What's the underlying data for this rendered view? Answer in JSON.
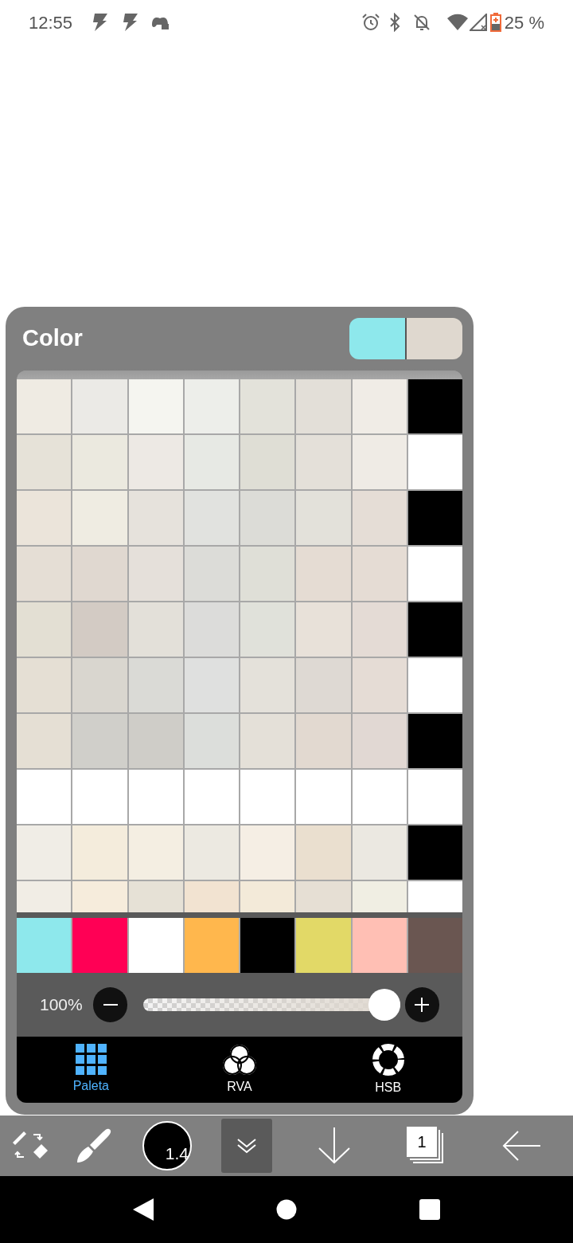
{
  "status_bar": {
    "time": "12:55",
    "battery": "25 %"
  },
  "color_panel": {
    "title": "Color",
    "current_colors": [
      {
        "color": "#8ee8ec"
      },
      {
        "color": "#dfd8cf"
      }
    ],
    "palette": {
      "rows": [
        {
          "swatches": [
            {
              "color": "#efebe3"
            },
            {
              "color": "#ebeae6"
            },
            {
              "color": "#f5f5f0"
            },
            {
              "color": "#edeeea"
            },
            {
              "color": "#e3e2da"
            },
            {
              "color": "#e3dfd8"
            },
            {
              "color": "#f0ece6"
            },
            {
              "color": "#000000"
            }
          ]
        },
        {
          "swatches": [
            {
              "color": "#e6e2d8"
            },
            {
              "color": "#ebe9df"
            },
            {
              "color": "#ede9e4"
            },
            {
              "color": "#e7e9e4"
            },
            {
              "color": "#dfded5"
            },
            {
              "color": "#e4e0d9"
            },
            {
              "color": "#efebe5"
            },
            {
              "color": "#ffffff"
            }
          ]
        },
        {
          "swatches": [
            {
              "color": "#ebe4da"
            },
            {
              "color": "#efece2"
            },
            {
              "color": "#e6e2dc"
            },
            {
              "color": "#e1e2df"
            },
            {
              "color": "#dcdcd7"
            },
            {
              "color": "#e3e1da"
            },
            {
              "color": "#e5ddd6"
            },
            {
              "color": "#000000"
            }
          ]
        },
        {
          "swatches": [
            {
              "color": "#e5ded5"
            },
            {
              "color": "#e0d8d0"
            },
            {
              "color": "#e5e0da"
            },
            {
              "color": "#dcdcd8"
            },
            {
              "color": "#dfdfd7"
            },
            {
              "color": "#e5dcd3"
            },
            {
              "color": "#e5dcd4"
            },
            {
              "color": "#ffffff"
            }
          ]
        },
        {
          "swatches": [
            {
              "color": "#e3dfd3"
            },
            {
              "color": "#d3cbc4"
            },
            {
              "color": "#e3e0d9"
            },
            {
              "color": "#dcdcda"
            },
            {
              "color": "#e0e1da"
            },
            {
              "color": "#e8e1d9"
            },
            {
              "color": "#e4dbd5"
            },
            {
              "color": "#000000"
            }
          ]
        },
        {
          "swatches": [
            {
              "color": "#e5dfd4"
            },
            {
              "color": "#d9d6cf"
            },
            {
              "color": "#dadad6"
            },
            {
              "color": "#dfe0df"
            },
            {
              "color": "#e4e1da"
            },
            {
              "color": "#ded9d3"
            },
            {
              "color": "#e5dcd5"
            },
            {
              "color": "#ffffff"
            }
          ]
        },
        {
          "swatches": [
            {
              "color": "#e5dfd4"
            },
            {
              "color": "#d0cfca"
            },
            {
              "color": "#cfcdc8"
            },
            {
              "color": "#dcdedb"
            },
            {
              "color": "#e4e0d8"
            },
            {
              "color": "#e2d9d0"
            },
            {
              "color": "#e1d8d3"
            },
            {
              "color": "#000000"
            }
          ]
        },
        {
          "swatches": [
            {
              "color": "#ffffff"
            },
            {
              "color": "#ffffff"
            },
            {
              "color": "#ffffff"
            },
            {
              "color": "#ffffff"
            },
            {
              "color": "#ffffff"
            },
            {
              "color": "#ffffff"
            },
            {
              "color": "#ffffff"
            },
            {
              "color": "#ffffff"
            }
          ]
        },
        {
          "swatches": [
            {
              "color": "#f0ede6"
            },
            {
              "color": "#f4ecdc"
            },
            {
              "color": "#f4eee2"
            },
            {
              "color": "#ece9e1"
            },
            {
              "color": "#f5eee4"
            },
            {
              "color": "#eadfcf"
            },
            {
              "color": "#ebe8e1"
            },
            {
              "color": "#000000"
            }
          ]
        },
        {
          "swatches": [
            {
              "color": "#f1ede5"
            },
            {
              "color": "#f6ecdc"
            },
            {
              "color": "#e6e1d6"
            },
            {
              "color": "#f2e3d1"
            },
            {
              "color": "#f3ead9"
            },
            {
              "color": "#e6dfd4"
            },
            {
              "color": "#f0eee3"
            },
            {
              "color": "#ffffff"
            }
          ]
        }
      ]
    },
    "recent_colors": [
      {
        "color": "#8ee8ec"
      },
      {
        "color": "#ff0055"
      },
      {
        "color": "#ffffff"
      },
      {
        "color": "#ffb74d"
      },
      {
        "color": "#000000"
      },
      {
        "color": "#e2d967"
      },
      {
        "color": "#ffbfb4"
      },
      {
        "color": "#6a5651"
      }
    ],
    "opacity": {
      "reading": "100%",
      "level": 1
    },
    "tabs": [
      {
        "label": "Paleta",
        "kind": "grid",
        "selected": true
      },
      {
        "label": "RVA",
        "kind": "circles",
        "selected": false
      },
      {
        "label": "HSB",
        "kind": "ring",
        "selected": false
      }
    ]
  },
  "toolbar": {
    "brush_size": "1.4",
    "layer_count": "1"
  }
}
